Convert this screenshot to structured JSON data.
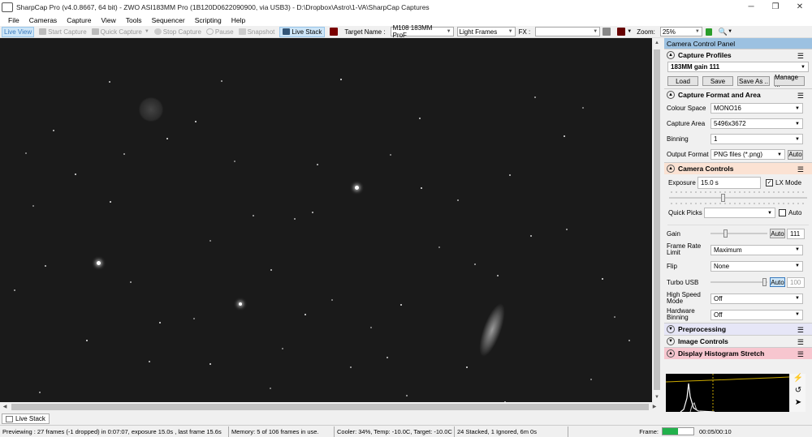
{
  "window": {
    "title": "SharpCap Pro (v4.0.8667, 64 bit) - ZWO ASI183MM Pro (1B120D0622090900, via USB3) - D:\\Dropbox\\Astro\\1-VA\\SharpCap Captures",
    "minimize": "─",
    "maximize": "❐",
    "close": "✕"
  },
  "menu": [
    "File",
    "Cameras",
    "Capture",
    "View",
    "Tools",
    "Sequencer",
    "Scripting",
    "Help"
  ],
  "toolbar": {
    "live_view": "Live View",
    "start_capture": "Start Capture",
    "quick_capture": "Quick Capture",
    "stop_capture": "Stop Capture",
    "pause": "Pause",
    "snapshot": "Snapshot",
    "live_stack": "Live Stack",
    "target_label": "Target Name :",
    "target_value": "M108 183MM ProF",
    "frame_type": "Light Frames",
    "fx_label": "FX :",
    "zoom_label": "Zoom:",
    "zoom_value": "25%"
  },
  "panel": {
    "title": "Camera Control Panel",
    "capture_profiles": {
      "heading": "Capture Profiles",
      "profile": "183MM gain 111",
      "buttons": [
        "Load",
        "Save",
        "Save As ..",
        "Manage ..."
      ]
    },
    "format": {
      "heading": "Capture Format and Area",
      "colour_space_label": "Colour Space",
      "colour_space": "MONO16",
      "capture_area_label": "Capture Area",
      "capture_area": "5496x3672",
      "binning_label": "Binning",
      "binning": "1",
      "output_format_label": "Output Format",
      "output_format": "PNG files (*.png)",
      "auto": "Auto"
    },
    "camera_controls": {
      "heading": "Camera Controls",
      "exposure_label": "Exposure",
      "exposure": "15.0 s",
      "lx_mode": "LX Mode",
      "quick_picks_label": "Quick Picks",
      "quick_picks_auto": "Auto",
      "gain_label": "Gain",
      "gain_auto": "Auto",
      "gain_value": "111",
      "frame_rate_label": "Frame Rate Limit",
      "frame_rate": "Maximum",
      "flip_label": "Flip",
      "flip": "None",
      "turbo_label": "Turbo USB",
      "turbo_auto": "Auto",
      "turbo_value": "100",
      "hsm_label": "High Speed Mode",
      "hsm": "Off",
      "hwbin_label": "Hardware Binning",
      "hwbin": "Off"
    },
    "preprocessing": "Preprocessing",
    "image_controls": "Image Controls",
    "histogram": "Display Histogram Stretch"
  },
  "tab": "Live Stack",
  "status": {
    "previewing": "Previewing : 27 frames (-1 dropped) in 0:07:07, exposure 15.0s , last frame 15.6s",
    "memory": "Memory: 5 of 106 frames in use.",
    "cooler": "Cooler: 34%, Temp: -10.0C, Target: -10.0C",
    "stacked": "24 Stacked, 1 Ignored, 6m 0s",
    "frame_label": "Frame:",
    "frame_counter": "00:05/00:10"
  },
  "colors": {
    "accent": "#9cc1e1",
    "highlight_section": "#fbe2d3",
    "histogram_section": "#f7c6cf",
    "frame_progress": "#22b14c"
  },
  "frame_progress": 0.5
}
